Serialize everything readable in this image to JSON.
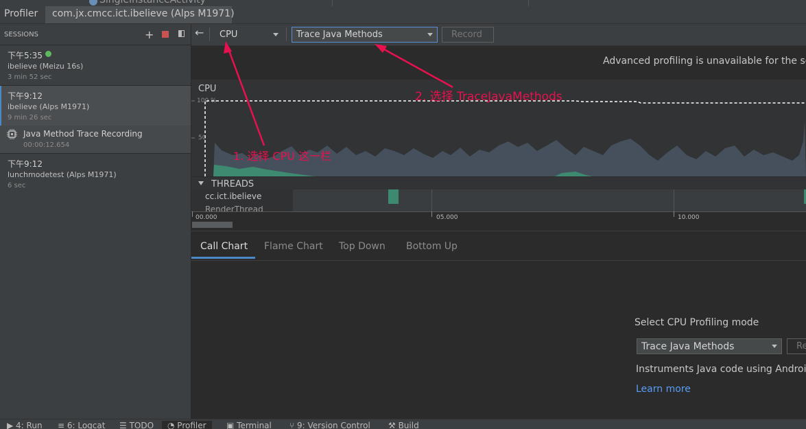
{
  "top_tabs": {
    "profiler": "Profiler",
    "app_session": "com.jx.cmcc.ict.ibelieve (Alps M1971)",
    "overflow_fragment": "SingleInstanceActivity"
  },
  "sidebar": {
    "header": "SESSIONS",
    "sessions": [
      {
        "time": "下午5:35",
        "device": "ibelieve (Meizu 16s)",
        "duration": "3 min 52 sec",
        "live": true
      },
      {
        "time": "下午9:12",
        "device": "ibelieve (Alps M1971)",
        "duration": "9 min 26 sec"
      },
      {
        "time": "下午9:12",
        "device": "lunchmodetest (Alps M1971)",
        "duration": "6 sec"
      }
    ],
    "recording": {
      "title": "Java Method Trace Recording",
      "duration": "00:00:12.654"
    }
  },
  "toolbar": {
    "monitor_selected": "CPU",
    "config_selected": "Trace Java Methods",
    "record_label": "Record"
  },
  "banner": "Advanced profiling is unavailable for the se",
  "cpu": {
    "title": "CPU",
    "tick_100": "100 %",
    "tick_50": "50"
  },
  "threads": {
    "header": "THREADS",
    "rows": [
      "cc.ict.ibelieve",
      "RenderThread"
    ]
  },
  "time_axis": {
    "labels": [
      "00.000",
      "05.000",
      "10.000"
    ]
  },
  "analysis_tabs": [
    "Call Chart",
    "Flame Chart",
    "Top Down",
    "Bottom Up"
  ],
  "empty_state": {
    "heading": "Select CPU Profiling mode",
    "mode_selected": "Trace Java Methods",
    "record_fragment": "Re",
    "description": "Instruments Java code using Androi",
    "learn_more": "Learn more"
  },
  "annotations": {
    "step1": "1. 选择 CPU 这一栏",
    "step2": "2. 选择 TraceJavaMethods"
  },
  "statusbar": [
    "4: Run",
    "6: Logcat",
    "TODO",
    "Profiler",
    "Terminal",
    "9: Version Control",
    "Build"
  ],
  "colors": {
    "accent_blue": "#589df6",
    "annotation_red": "#e8114f",
    "live_green": "#5fb85f",
    "cpu_area": "#45505c",
    "thread_green": "#3d8a70",
    "stop_red": "#c75450"
  }
}
